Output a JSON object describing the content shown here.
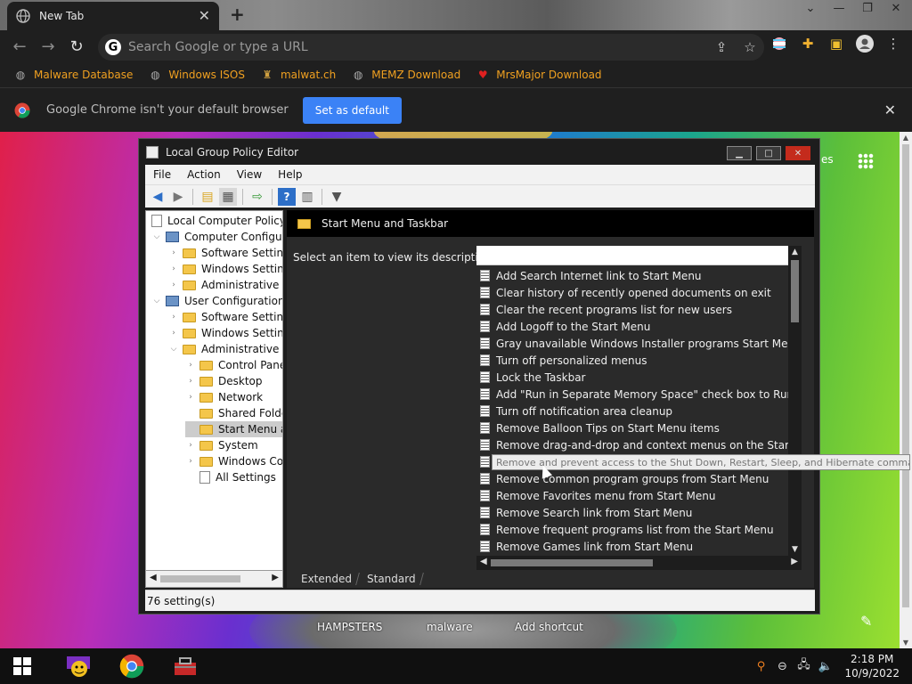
{
  "browser": {
    "tab_title": "New Tab",
    "omnibox_placeholder": "Search Google or type a URL",
    "bookmarks": [
      {
        "label": "Malware Database"
      },
      {
        "label": "Windows ISOS"
      },
      {
        "label": "malwat.ch"
      },
      {
        "label": "MEMZ Download"
      },
      {
        "label": "MrsMajor Download"
      }
    ],
    "infobar": {
      "message": "Google Chrome isn't your default browser",
      "button": "Set as default"
    },
    "accent_color": "#3b82f6",
    "bookmark_color": "#f0a020"
  },
  "page": {
    "partial_text": "es",
    "shortcuts": [
      "HAMPSTERS",
      "malware",
      "Add shortcut"
    ]
  },
  "gpedit": {
    "title": "Local Group Policy Editor",
    "menu": [
      "File",
      "Action",
      "View",
      "Help"
    ],
    "tree": [
      {
        "label": "Local Computer Policy",
        "level": 0,
        "type": "doc"
      },
      {
        "label": "Computer Configura",
        "level": 0,
        "type": "pc",
        "exp": "v"
      },
      {
        "label": "Software Settings",
        "level": 1,
        "type": "folder",
        "exp": ">"
      },
      {
        "label": "Windows Setting",
        "level": 1,
        "type": "folder",
        "exp": ">"
      },
      {
        "label": "Administrative Te",
        "level": 1,
        "type": "folder",
        "exp": ">"
      },
      {
        "label": "User Configuration",
        "level": 0,
        "type": "pc",
        "exp": "v"
      },
      {
        "label": "Software Settings",
        "level": 1,
        "type": "folder",
        "exp": ">"
      },
      {
        "label": "Windows Setting",
        "level": 1,
        "type": "folder",
        "exp": ">"
      },
      {
        "label": "Administrative Te",
        "level": 1,
        "type": "folder",
        "exp": "v"
      },
      {
        "label": "Control Panel",
        "level": 2,
        "type": "folder",
        "exp": ">"
      },
      {
        "label": "Desktop",
        "level": 2,
        "type": "folder",
        "exp": ">"
      },
      {
        "label": "Network",
        "level": 2,
        "type": "folder",
        "exp": ">"
      },
      {
        "label": "Shared Folder",
        "level": 2,
        "type": "folder",
        "exp": ""
      },
      {
        "label": "Start Menu ar",
        "level": 2,
        "type": "folder",
        "exp": "",
        "selected": true
      },
      {
        "label": "System",
        "level": 2,
        "type": "folder",
        "exp": ">"
      },
      {
        "label": "Windows Cor",
        "level": 2,
        "type": "folder",
        "exp": ">"
      },
      {
        "label": "All Settings",
        "level": 2,
        "type": "doc",
        "exp": ""
      }
    ],
    "right_header": "Start Menu and Taskbar",
    "description_prompt": "Select an item to view its description.",
    "settings": [
      "Add Search Internet link to Start Menu",
      "Clear history of recently opened documents on exit",
      "Clear the recent programs list for new users",
      "Add Logoff to the Start Menu",
      "Gray unavailable Windows Installer programs Start Menu sh...",
      "Turn off personalized menus",
      "Lock the Taskbar",
      "Add \"Run in Separate Memory Space\" check box to Run dial...",
      "Turn off notification area cleanup",
      "Remove Balloon Tips on Start Menu items",
      "Remove drag-and-drop and context menus on the Start Me...",
      "Remove and prevent access to the Shut Down, Restart, Sleep",
      "Remove common program groups from Start Menu",
      "Remove Favorites menu from Start Menu",
      "Remove Search link from Start Menu",
      "Remove frequent programs list from the Start Menu",
      "Remove Games link from Start Menu"
    ],
    "hover_index": 11,
    "tooltip": "Remove and prevent access to the Shut Down, Restart, Sleep, and Hibernate commands",
    "view_tabs": [
      "Extended",
      "Standard"
    ],
    "status": "76 setting(s)"
  },
  "taskbar": {
    "time": "2:18 PM",
    "date": "10/9/2022"
  }
}
